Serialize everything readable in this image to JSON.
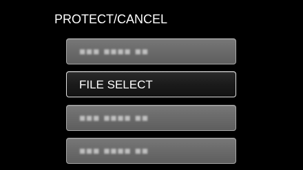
{
  "menu": {
    "title": "PROTECT/CANCEL",
    "items": [
      {
        "label": "■■■ ■■■■ ■■",
        "state": "disabled"
      },
      {
        "label": "FILE SELECT",
        "state": "selected"
      },
      {
        "label": "■■■ ■■■■ ■■",
        "state": "disabled"
      },
      {
        "label": "■■■ ■■■■ ■■",
        "state": "disabled"
      }
    ]
  },
  "colors": {
    "background": "#000000",
    "button_default": "#6a6a6a",
    "button_selected": "#1b1b1b",
    "text": "#ffffff"
  }
}
